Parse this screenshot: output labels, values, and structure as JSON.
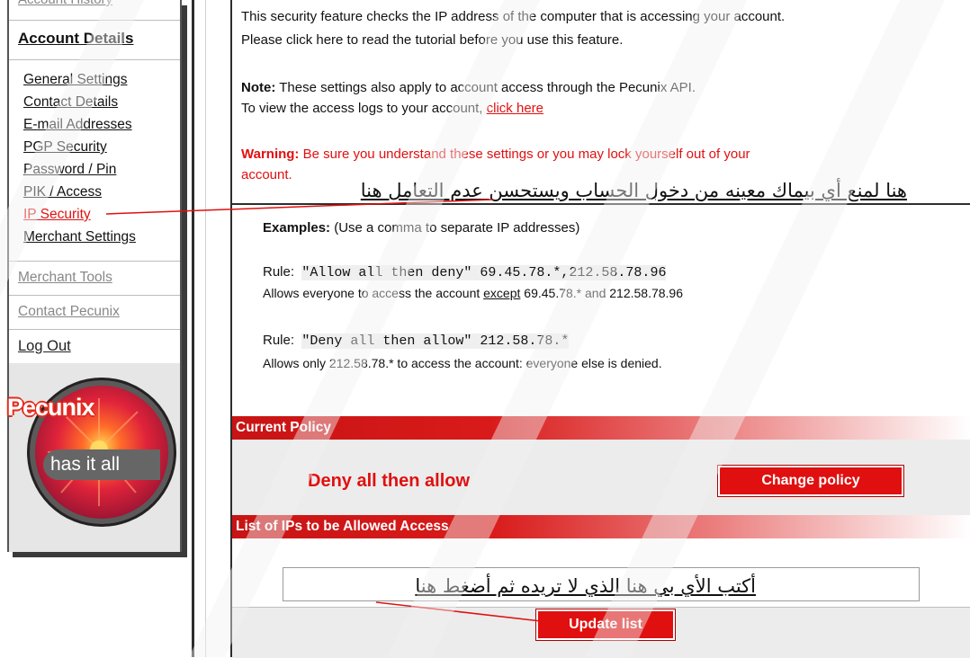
{
  "sidebar": {
    "account_history": "Account History",
    "account_details_heading": "Account Details",
    "account_links": [
      {
        "label": "General Settings",
        "active": false
      },
      {
        "label": "Contact Details",
        "active": false
      },
      {
        "label": "E-mail Addresses",
        "active": false
      },
      {
        "label": "PGP Security",
        "active": false
      },
      {
        "label": "Password / Pin",
        "active": false
      },
      {
        "label": "PIK / Access",
        "active": false
      },
      {
        "label": "IP Security",
        "active": true
      },
      {
        "label": "Merchant Settings",
        "active": false
      }
    ],
    "merchant_tools": "Merchant Tools",
    "contact_pecunix": "Contact Pecunix",
    "log_out": "Log Out",
    "promo": {
      "brand": "Pecunix",
      "tagline": "has it all",
      "icon": "flower-badge-icon"
    }
  },
  "intro": {
    "line1": "This security feature checks the IP address of the computer that is accessing your account.",
    "line2": "Please click here to read the tutorial before you use this feature.",
    "note_label": "Note:",
    "note_text": " These settings also apply to account access through the Pecunix API.",
    "logs_text": "To view the access logs to your account, ",
    "logs_link": "click here",
    "warning_label": "Warning:",
    "warning_text_1": " Be sure you understand these settings or you may lock yourself out of your",
    "warning_text_2": "account."
  },
  "annotations": {
    "top_arabic": "هنا لمنع أي بيماك معينه من دخول الحساب ويستحسن عدم التعامل هنا",
    "input_arabic": "أكتب الأي بي هنا الذي لا تريده ثم أضغط هنا"
  },
  "examples": {
    "heading": "Examples:",
    "heading_note": " (Use a comma to separate IP addresses)",
    "rule_label": "Rule:",
    "rule1_code": "\"Allow all then deny\" 69.45.78.*,212.58.78.96",
    "rule1_desc_a": "Allows everyone to access the account ",
    "rule1_desc_except": "except",
    "rule1_desc_b": " 69.45.78.* and 212.58.78.96",
    "rule2_code": "\"Deny all then allow\" 212.58.78.*",
    "rule2_desc": "Allows only 212.58.78.* to access the account: everyone else is denied."
  },
  "current_policy": {
    "header": "Current Policy",
    "value": "Deny all then allow",
    "change_button": "Change policy"
  },
  "allowed_list": {
    "header": "List of IPs to be Allowed Access",
    "input_value": "",
    "update_button": "Update list"
  },
  "colors": {
    "accent_red": "#e01010",
    "bar_red": "#c81414",
    "panel_grey": "#ececec"
  }
}
